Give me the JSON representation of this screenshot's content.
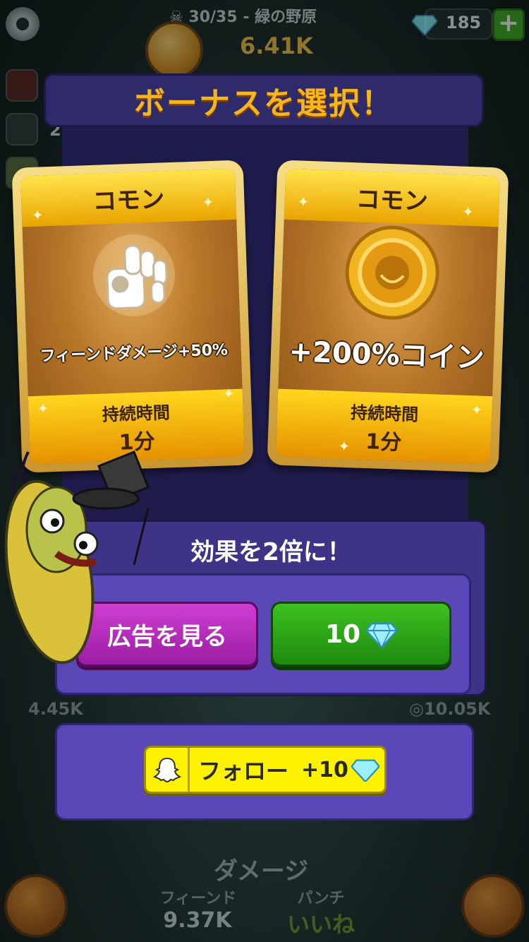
{
  "hud": {
    "stage_progress": "30/35",
    "stage_name": "緑の野原",
    "coin_total": "6.41K",
    "gem_count": "185",
    "plus_label": "+",
    "side_count": "2"
  },
  "header": {
    "title": "ボーナスを選択！"
  },
  "cards": [
    {
      "rarity": "コモン",
      "description": "フィーンドダメージ+50%",
      "duration_label": "持続時間",
      "duration_value": "1分",
      "icon": "fist-icon"
    },
    {
      "rarity": "コモン",
      "description": "+200%コイン",
      "duration_label": "持続時間",
      "duration_value": "1分",
      "icon": "coin-icon"
    }
  ],
  "double": {
    "title": "効果を2倍に！",
    "ad_button": "広告を見る",
    "gem_button": "10"
  },
  "follow": {
    "label": "フォロー",
    "bonus": "+10",
    "icon": "snapchat-ghost-icon"
  },
  "battle": {
    "enemy_hp_left": "4.45K",
    "enemy_hp_right": "10.05K",
    "damage_title": "ダメージ",
    "fiend_label": "フィーンド",
    "punch_label": "パンチ",
    "fiend_value": "9.37K",
    "punch_value": "いいね"
  },
  "colors": {
    "header_text": "#f7b51c",
    "panel": "#2f2b6b",
    "ad_button": "#b42cba",
    "gem_button": "#2ea51a",
    "snap_yellow": "#fff200"
  }
}
